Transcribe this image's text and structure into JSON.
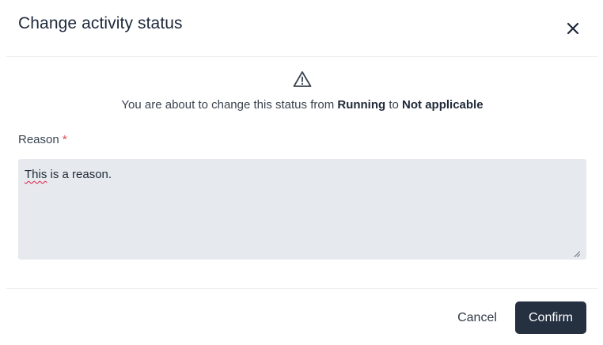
{
  "dialog": {
    "title": "Change activity status",
    "message": {
      "prefix": "You are about to change this status from ",
      "from_status": "Running",
      "connector": " to ",
      "to_status": "Not applicable"
    },
    "reason": {
      "label": "Reason",
      "required_marker": "*",
      "value_first_word": "This",
      "value_rest": " is a reason."
    },
    "buttons": {
      "cancel_label": "Cancel",
      "confirm_label": "Confirm"
    },
    "icons": {
      "close": "close-icon",
      "warning": "warning-triangle-icon",
      "resize": "resize-handle-icon"
    },
    "colors": {
      "primary": "#253041",
      "required": "#e5484d",
      "input_background": "#e6e9ed"
    }
  }
}
